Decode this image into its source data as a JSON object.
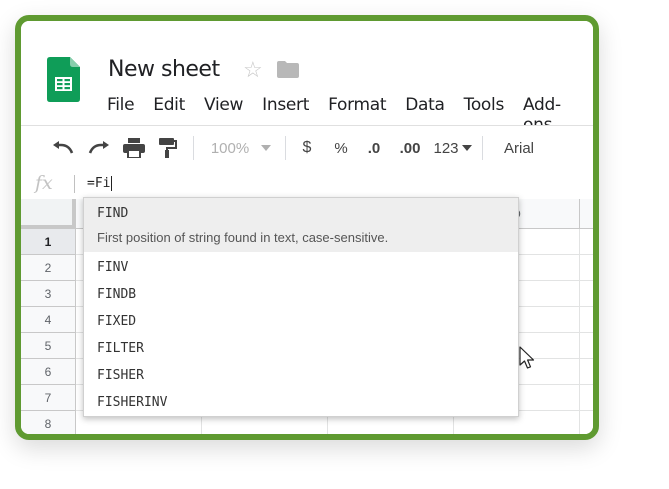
{
  "document": {
    "title": "New sheet"
  },
  "menu": [
    "File",
    "Edit",
    "View",
    "Insert",
    "Format",
    "Data",
    "Tools",
    "Add-ons"
  ],
  "toolbar": {
    "zoom": "100%",
    "currency": "$",
    "percent": "%",
    "decrease_decimals": ".0",
    "increase_decimals": ".00",
    "more_formats": "123",
    "font": "Arial"
  },
  "formula_bar": {
    "fx_label": "fx",
    "value": "=Fi"
  },
  "grid": {
    "column_d": "D",
    "rows": [
      "1",
      "2",
      "3",
      "4",
      "5",
      "6",
      "7",
      "8"
    ]
  },
  "autocomplete": {
    "highlighted": {
      "name": "FIND",
      "description": "First position of string found in text, case-sensitive."
    },
    "items": [
      "FINV",
      "FINDB",
      "FIXED",
      "FILTER",
      "FISHER",
      "FISHERINV"
    ]
  },
  "colors": {
    "frame": "#5f9a31",
    "sheets_green": "#0f9d58"
  },
  "icons": [
    "sheets-logo-icon",
    "star-icon",
    "folder-icon",
    "undo-icon",
    "redo-icon",
    "print-icon",
    "paint-format-icon",
    "chevron-down-icon",
    "mouse-pointer-icon"
  ]
}
